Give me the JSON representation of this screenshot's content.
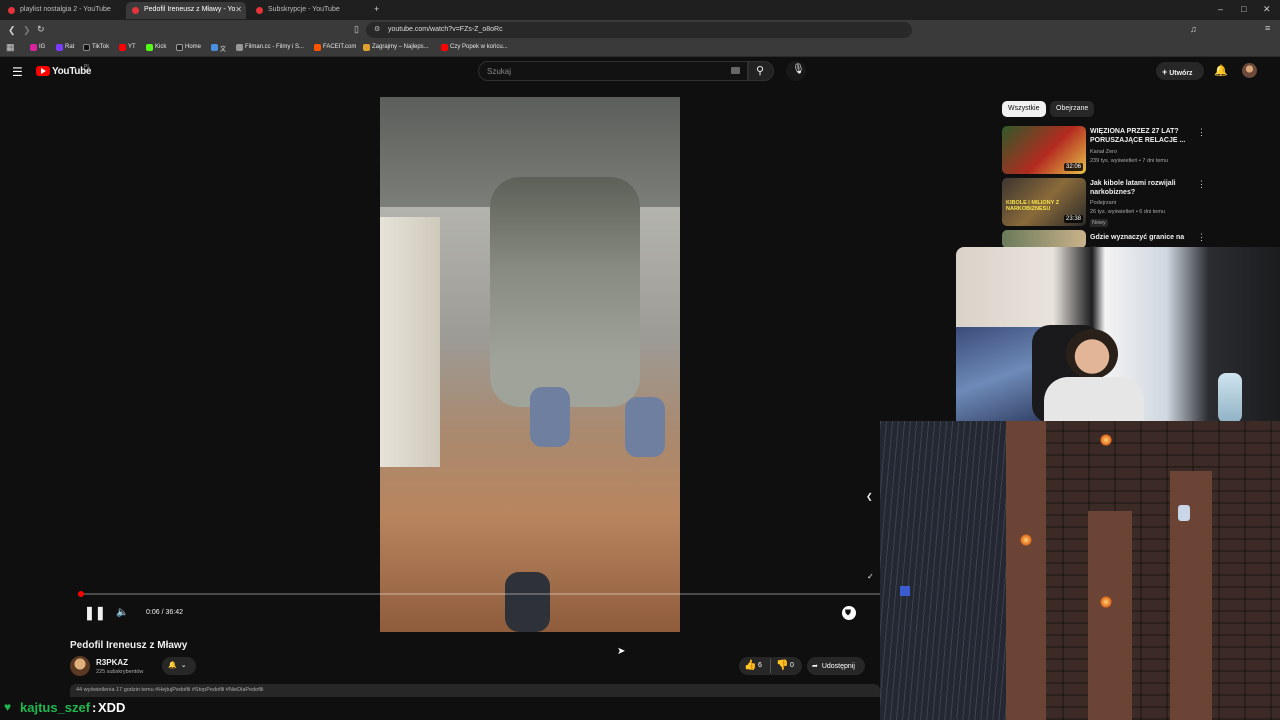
{
  "browser": {
    "tabs": [
      {
        "label": "playlist nostalgia 2 - YouTube"
      },
      {
        "label": "Pedofil Ireneusz z Mławy - Yo"
      },
      {
        "label": "Subskrypcje - YouTube"
      }
    ],
    "new_tab": "+",
    "url": "youtube.com/watch?v=FZs-Z_o8oRc",
    "bookmarks": [
      "IG",
      "Rat",
      "TikTok",
      "YT",
      "Kick",
      "Home",
      "文",
      "Filman.cc - Filmy i S...",
      "FACEIT.com",
      "Zagrajmy – Najleps...",
      "Czy Popek w końcu..."
    ]
  },
  "youtube": {
    "logo": "YouTube",
    "logo_region": "PL",
    "search_placeholder": "Szukaj",
    "create_label": "Utwórz"
  },
  "player": {
    "time": "0:06 / 36:42",
    "progress": 0.003
  },
  "video": {
    "title": "Pedofil Ireneusz z Mławy",
    "channel": "R3PKAZ",
    "subscribers": "225 subskrybentów",
    "likes": "6",
    "dislikes": "0",
    "share_label": "Udostępnij",
    "description_snippet": "44 wyświetlenia  17 godzin temu  #HejtujPedofili #StopPedofili #NieDlaPedofili"
  },
  "sidebar": {
    "chips": [
      "Wszystkie",
      "Obejrzane"
    ],
    "recommendations": [
      {
        "title": "WIĘZIONA PRZEZ 27 LAT? PORUSZAJĄCE RELACJE ...",
        "channel": "Kanał Zero",
        "meta": "239 tys. wyświetleń • 7 dni temu",
        "duration": "32:06"
      },
      {
        "title": "Jak kibole latami rozwijali narkobiznes?",
        "channel": "Podejrzani",
        "meta": "26 tys. wyświetleń • 6 dni temu",
        "duration": "23:38",
        "badge": "Nowy",
        "thumb_text": "KIBOLE I MILIONY Z NARKOBIZNESU"
      },
      {
        "title": "Gdzie wyznaczyć granice na ...",
        "channel": "",
        "meta": "",
        "duration": ""
      }
    ]
  },
  "chat": {
    "user": "kajtus_szef",
    "message": "XDD"
  },
  "colors": {
    "brand": "#ff0000",
    "chat_user": "#1fb84f",
    "background": "#0f0f0f"
  }
}
